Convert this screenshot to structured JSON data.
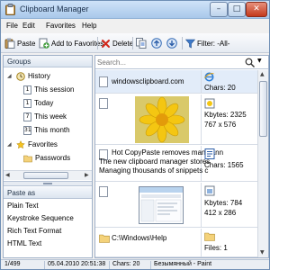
{
  "window": {
    "title": "Clipboard Manager"
  },
  "menu": [
    "File",
    "Edit",
    "Favorites",
    "Help"
  ],
  "toolbar": {
    "paste": "Paste",
    "add_to_favorites": "Add to Favorites",
    "delete": "Delete",
    "filter": "Filter: -All-"
  },
  "groups": {
    "header": "Groups",
    "history": "History",
    "history_items": [
      "This session",
      "Today",
      "This week",
      "This month"
    ],
    "history_day_numbers": [
      "1",
      "1",
      "7",
      "31"
    ],
    "favorites": "Favorites",
    "favorites_items": [
      "Passwords"
    ]
  },
  "paste_as": {
    "header": "Paste as",
    "items": [
      "Plain Text",
      "Keystroke Sequence",
      "Rich Text Format",
      "HTML Text"
    ]
  },
  "search": {
    "placeholder": "Search..."
  },
  "clips": [
    {
      "kind": "url",
      "text": "windowsclipboard.com",
      "info": [
        "Chars: 20"
      ]
    },
    {
      "kind": "image",
      "info": [
        "Kbytes: 2325",
        "767 x 576"
      ]
    },
    {
      "kind": "text",
      "lines": [
        "Hot CopyPaste removes many ann",
        "The new clipboard manager stores",
        "Managing thousands of snippets c"
      ],
      "info": [
        "Chars: 1565"
      ]
    },
    {
      "kind": "screenshot",
      "info": [
        "Kbytes: 784",
        "412 x 286"
      ]
    },
    {
      "kind": "files",
      "text": "C:\\Windows\\Help",
      "info": [
        "Files: 1"
      ]
    }
  ],
  "status": {
    "position": "1/499",
    "date": "05.04.2010 20:51:38",
    "chars": "Chars: 20",
    "source": "Безымянный - Paint"
  },
  "colors": {
    "accent": "#316ac5",
    "title_bar": "#b9d3ee",
    "selection": "#e2ecf9"
  }
}
